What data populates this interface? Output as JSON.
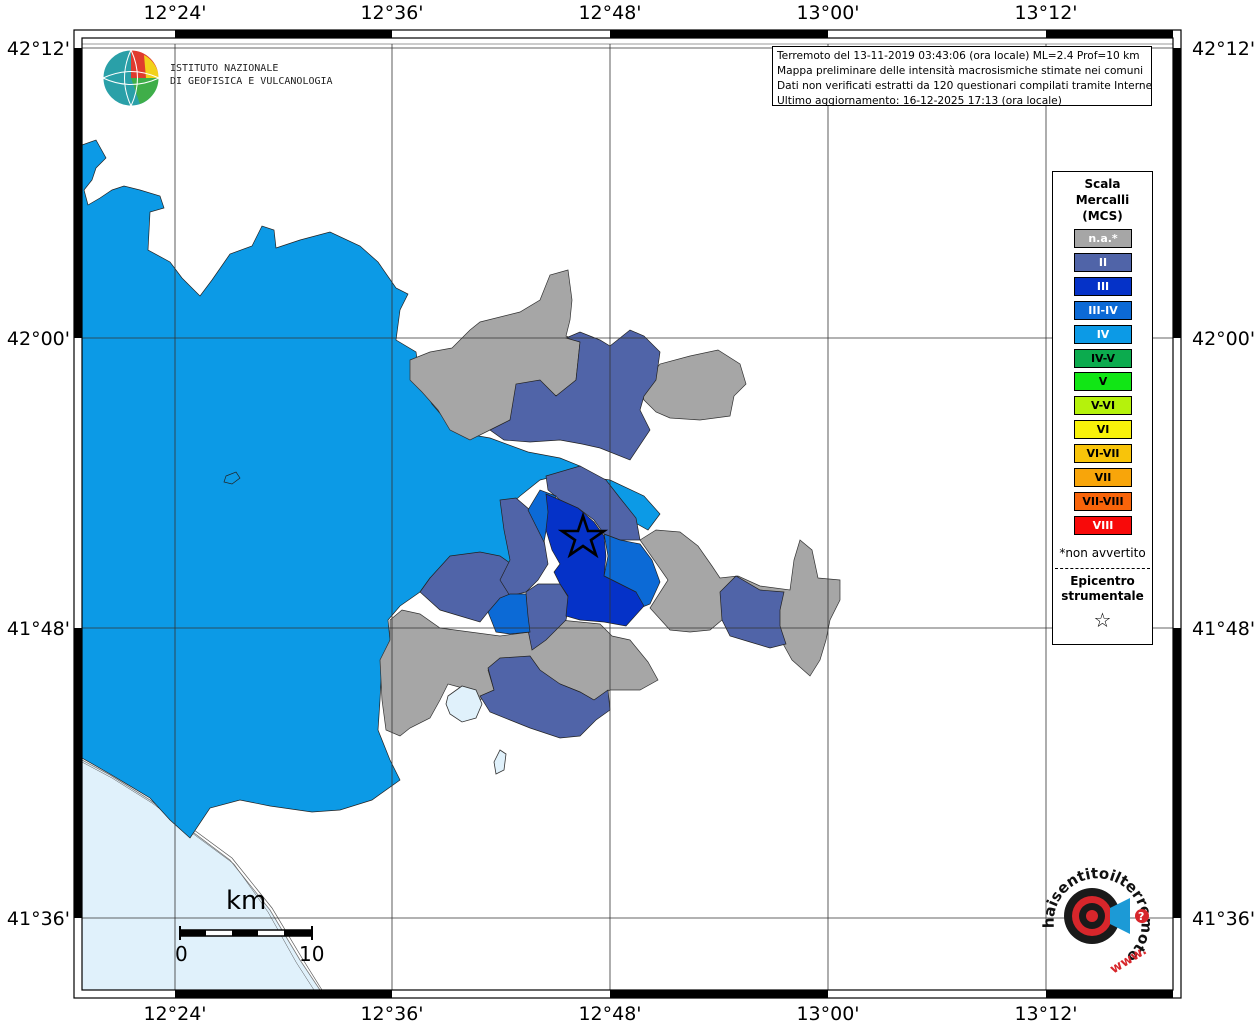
{
  "map": {
    "top_lon_labels": [
      "12°24'",
      "12°36'",
      "12°48'",
      "13°00'",
      "13°12'"
    ],
    "bottom_lon_labels": [
      "12°24'",
      "12°36'",
      "12°48'",
      "13°00'",
      "13°12'"
    ],
    "left_lat_labels": [
      "42°12'",
      "42°00'",
      "41°48'",
      "41°36'"
    ],
    "right_lat_labels": [
      "42°12'",
      "42°00'",
      "41°48'",
      "41°36'"
    ],
    "colors": {
      "sea": "#e0f1fb",
      "na": "#a6a6a6",
      "II": "#5064a8",
      "III": "#0532c8",
      "III_IV": "#0c6ad6",
      "IV": "#0c9ae6",
      "lake": "#e0f1fb",
      "epicenter": "#000000"
    }
  },
  "info": {
    "line1": "Terremoto del 13-11-2019 03:43:06 (ora locale) ML=2.4 Prof=10 km",
    "line2": "Mappa preliminare delle intensità macrosismiche stimate nei comuni",
    "line3": "Dati non verificati estratti da 120 questionari compilati tramite Internet.",
    "line4": "Ultimo aggiornamento: 16-12-2025 17:13 (ora locale)"
  },
  "legend": {
    "title1": "Scala",
    "title2": "Mercalli",
    "title3": "(MCS)",
    "items": [
      {
        "label": "n.a.*",
        "color": "#a6a6a6"
      },
      {
        "label": "II",
        "color": "#5064a8"
      },
      {
        "label": "III",
        "color": "#0532c8"
      },
      {
        "label": "III-IV",
        "color": "#0c6ad6"
      },
      {
        "label": "IV",
        "color": "#0c9ae6"
      },
      {
        "label": "IV-V",
        "color": "#0cab4e"
      },
      {
        "label": "V",
        "color": "#11e615"
      },
      {
        "label": "V-VI",
        "color": "#b5f20c"
      },
      {
        "label": "VI",
        "color": "#f8f20a"
      },
      {
        "label": "VI-VII",
        "color": "#f8c40a"
      },
      {
        "label": "VII",
        "color": "#f8a50a"
      },
      {
        "label": "VII-VIII",
        "color": "#f8640a"
      },
      {
        "label": "VIII",
        "color": "#f80a0a"
      }
    ],
    "note": "*non avvertito",
    "epicenter_line1": "Epicentro",
    "epicenter_line2": "strumentale",
    "epicenter_symbol": "☆"
  },
  "ingv": {
    "line1": "ISTITUTO NAZIONALE",
    "line2": "DI GEOFISICA E VULCANOLOGIA"
  },
  "scale_bar": {
    "unit": "km",
    "min_label": "0",
    "max_label": "10"
  },
  "hst": {
    "text": "haisentitoilterremoto.it",
    "www": "www."
  }
}
